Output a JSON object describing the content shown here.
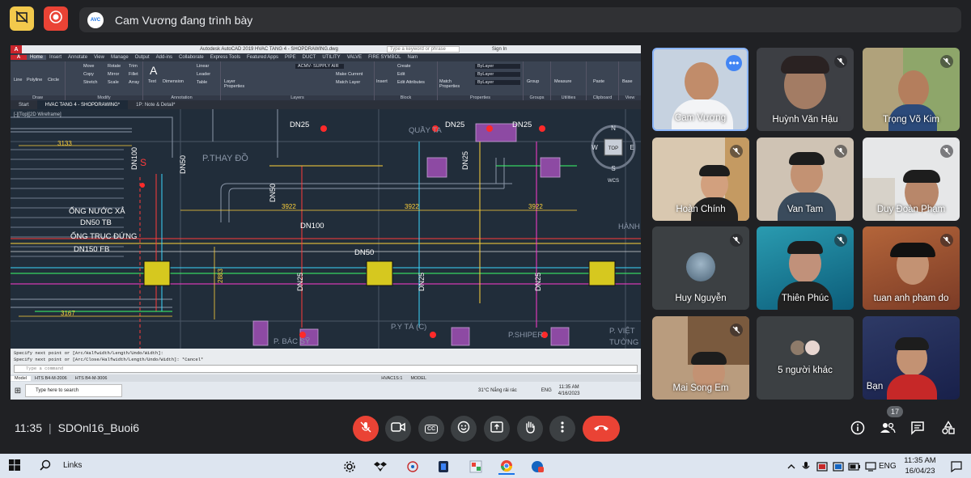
{
  "top_bar": {
    "presenter_avatar_text": "AVC",
    "presenter_text": "Cam Vương đang trình bày",
    "colors": {
      "no_record": "#f2c94c",
      "record": "#ea4335"
    }
  },
  "shared_screen": {
    "app_title": "Autodesk AutoCAD 2019   HVAC TANG 4 - SHOPDRAWING.dwg",
    "search_placeholder": "Type a keyword or phrase",
    "sign_in": "Sign In",
    "ribbon_tabs": [
      "Home",
      "Insert",
      "Annotate",
      "View",
      "Manage",
      "Output",
      "Add-ins",
      "Collaborate",
      "Express Tools",
      "Featured Apps",
      "PIPE",
      "DUCT",
      "UTILITY",
      "VALVE",
      "FIRE SYMBOL",
      "Nam"
    ],
    "ribbon_groups": [
      "Draw",
      "Modify",
      "Annotation",
      "Layers",
      "Block",
      "Properties",
      "Groups",
      "Utilities",
      "Clipboard",
      "View"
    ],
    "draw_tools": [
      "Line",
      "Polyline",
      "Circle",
      "Arc"
    ],
    "modify_tools": [
      "Move",
      "Rotate",
      "Trim",
      "Copy",
      "Mirror",
      "Fillet",
      "Stretch",
      "Scale",
      "Array"
    ],
    "annotation_tools": [
      "Text",
      "Dimension",
      "Linear",
      "Leader",
      "Table"
    ],
    "layer_tools": [
      "Layer Properties",
      "ACMV- SUPPLY AIR",
      "Make Current",
      "Match Layer"
    ],
    "block_tools": [
      "Insert",
      "Create",
      "Edit",
      "Edit Attributes"
    ],
    "property_tools": [
      "Match Properties",
      "ByLayer",
      "ByLayer",
      "ByLayer"
    ],
    "other_tools": [
      "Group",
      "Measure",
      "Paste",
      "Base"
    ],
    "doc_tabs": [
      "Start",
      "HVAC TANG 4 - SHOPDRAWING*",
      "1P: Note & Detail*"
    ],
    "viewport_label": "[-][Top][2D Wireframe]",
    "drawing_labels": {
      "dn25_a": "DN25",
      "dn25_b": "DN25",
      "dn25_c": "DN25",
      "quay": "QUẦY TA",
      "dim_3133": "3133",
      "dim_3922_a": "3922",
      "dim_3922_b": "3922",
      "dim_3922_c": "3922",
      "dim_3167": "3167",
      "dim_2883": "2883",
      "dn100_v": "DN100",
      "dn50_v1": "DN50",
      "dn50_v2": "DN50",
      "p_thay_do": "P.THAY ĐỒ",
      "ong_nuoc_xa": "ỐNG NƯỚC XẢ",
      "dn50_tb": "DN50 TB",
      "ong_truc_dung": "ỐNG TRỤC ĐỨNG",
      "dn150_fb": "DN150 FB",
      "dn100_h": "DN100",
      "dn50_h": "DN50",
      "dn25_v1": "DN25",
      "dn25_v2": "DN25",
      "dn25_v3": "DN25",
      "p_y_ta": "P.Y TÁ (C)",
      "bac_sy": "P. BÁC SỸ",
      "p_shiper": "P.SHIPER",
      "p_viet": "P. VIỆT",
      "tuong": "TƯỜNG",
      "hanh": "HÀNH",
      "compass": {
        "n": "N",
        "s": "S",
        "e": "E",
        "w": "W",
        "top": "TOP"
      },
      "wcs": "WCS",
      "s_mark": "S"
    },
    "command_lines": [
      "Specify next point or [Arc/Halfwidth/Length/Undo/Width]:",
      "Specify next point or [Arc/Close/Halfwidth/Length/Undo/Width]: *Cancel*"
    ],
    "command_placeholder": "Type a command",
    "layout_tabs": [
      "Model",
      "HTS B4-M-2006",
      "HTS B4-M-3006"
    ],
    "status_items": [
      "HVAC1S:1",
      "MODEL"
    ],
    "taskbar": {
      "search": "Type here to search",
      "weather": "31°C  Nắng rải rác",
      "lang": "ENG",
      "time": "11:35 AM",
      "date": "4/16/2023"
    }
  },
  "participants": [
    {
      "name": "Cam Vương",
      "muted": false,
      "more": true
    },
    {
      "name": "Huỳnh Văn Hậu",
      "muted": true
    },
    {
      "name": "Trọng Võ Kim",
      "muted": true
    },
    {
      "name": "Hoàn Chính",
      "muted": true
    },
    {
      "name": "Van Tam",
      "muted": true
    },
    {
      "name": "Duy Đoàn Phạm",
      "muted": true
    },
    {
      "name": "Huy Nguyễn",
      "muted": true
    },
    {
      "name": "Thiên Phúc",
      "muted": true
    },
    {
      "name": "tuan anh pham do",
      "muted": true
    },
    {
      "name": "Mai Song Em",
      "muted": true
    },
    {
      "name": "5 người khác",
      "muted": false
    },
    {
      "name": "Bạn",
      "muted": false
    }
  ],
  "bottom_bar": {
    "time": "11:35",
    "meeting_code": "SDOnl16_Buoi6",
    "people_count": "17",
    "cc_label": "CC",
    "colors": {
      "end_call": "#ea4335",
      "mic_off": "#ea4335"
    }
  },
  "windows_taskbar": {
    "links": "Links",
    "lang": "ENG",
    "time": "11:35 AM",
    "date": "16/04/23"
  }
}
